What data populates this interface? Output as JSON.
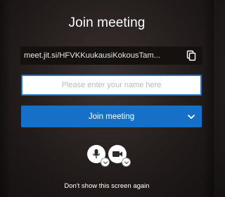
{
  "dialog": {
    "title": "Join meeting",
    "meeting_url": "meet.jit.si/HFVKKuukausiKokousTam...",
    "name_input": {
      "value": "",
      "placeholder": "Please enter your name here"
    },
    "join_button_label": "Join meeting",
    "dont_show_label": "Don't show this screen again"
  },
  "icons": {
    "copy": "copy-icon",
    "chevron": "chevron-down-icon",
    "microphone": "microphone-icon",
    "camera": "camera-icon"
  },
  "colors": {
    "accent": "#1670c8",
    "input_border": "#1b74c6",
    "background": "#231d1c",
    "url_bar": "#15110f"
  }
}
